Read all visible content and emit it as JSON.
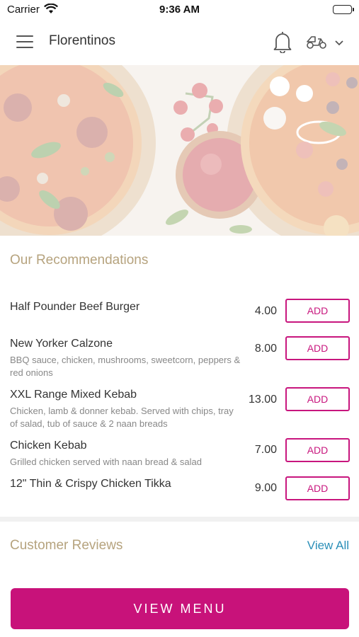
{
  "status_bar": {
    "carrier": "Carrier",
    "time": "9:36 AM"
  },
  "nav": {
    "title": "Florentinos",
    "icons": [
      "menu-icon",
      "bell-icon",
      "scooter-icon",
      "chevron-down-icon"
    ]
  },
  "hero": {
    "image": "pizza-hero-image"
  },
  "recommendations": {
    "title": "Our Recommendations",
    "items": [
      {
        "name": "Half Pounder Beef Burger",
        "description": "",
        "price": "4.00",
        "button": "ADD"
      },
      {
        "name": "New Yorker Calzone",
        "description": "BBQ sauce, chicken, mushrooms, sweetcorn, peppers & red onions",
        "price": "8.00",
        "button": "ADD"
      },
      {
        "name": "XXL Range Mixed Kebab",
        "description": "Chicken, lamb & donner kebab. Served with chips, tray of salad, tub of sauce & 2 naan breads",
        "price": "13.00",
        "button": "ADD"
      },
      {
        "name": "Chicken Kebab",
        "description": "Grilled chicken served with naan bread & salad",
        "price": "7.00",
        "button": "ADD"
      },
      {
        "name": "12\" Thin & Crispy Chicken Tikka",
        "description": "",
        "price": "9.00",
        "button": "ADD"
      }
    ]
  },
  "reviews": {
    "title": "Customer Reviews",
    "view_all": "View All"
  },
  "footer": {
    "view_menu": "VIEW MENU"
  },
  "colors": {
    "accent": "#c8127a",
    "section_title": "#b6a37e",
    "link": "#2b8fb8"
  }
}
